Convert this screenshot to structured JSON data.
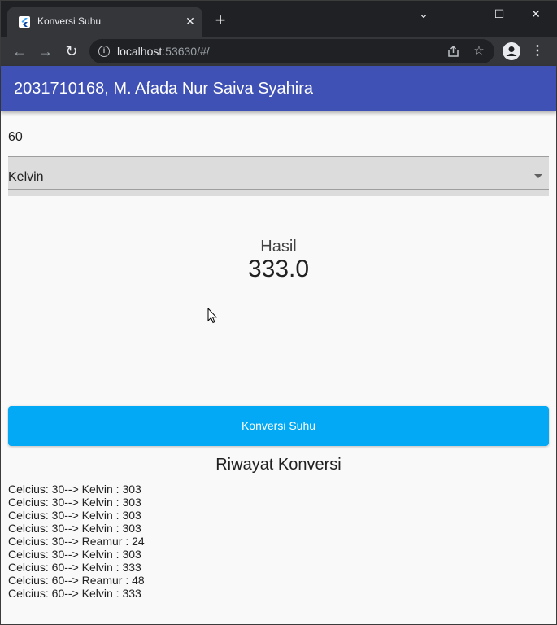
{
  "browser": {
    "tab_title": "Konversi Suhu",
    "tab_close": "✕",
    "new_tab": "+",
    "url_host": "localhost",
    "url_rest": ":53630/#/",
    "window_controls": {
      "collapse": "⌄",
      "minimize": "—",
      "maximize": "☐",
      "close": "✕"
    },
    "nav": {
      "back": "←",
      "forward": "→",
      "reload": "↻"
    },
    "icons": [
      "flutter-favicon-icon",
      "info-icon",
      "share-icon",
      "star-icon",
      "profile-icon",
      "menu-dots-icon"
    ]
  },
  "appbar": {
    "title": "2031710168, M. Afada Nur Saiva Syahira",
    "color": "#3f51b5"
  },
  "form": {
    "input_value": "60",
    "dropdown_selected": "Kelvin"
  },
  "result": {
    "label": "Hasil",
    "value": "333.0"
  },
  "button": {
    "label": "Konversi Suhu",
    "color": "#03a9f4"
  },
  "history": {
    "title": "Riwayat Konversi",
    "items": [
      "Celcius: 30--> Kelvin : 303",
      "Celcius: 30--> Kelvin : 303",
      "Celcius: 30--> Kelvin : 303",
      "Celcius: 30--> Kelvin : 303",
      "Celcius: 30--> Reamur : 24",
      "Celcius: 30--> Kelvin : 303",
      "Celcius: 60--> Kelvin : 333",
      "Celcius: 60--> Reamur : 48",
      "Celcius: 60--> Kelvin : 333"
    ]
  }
}
